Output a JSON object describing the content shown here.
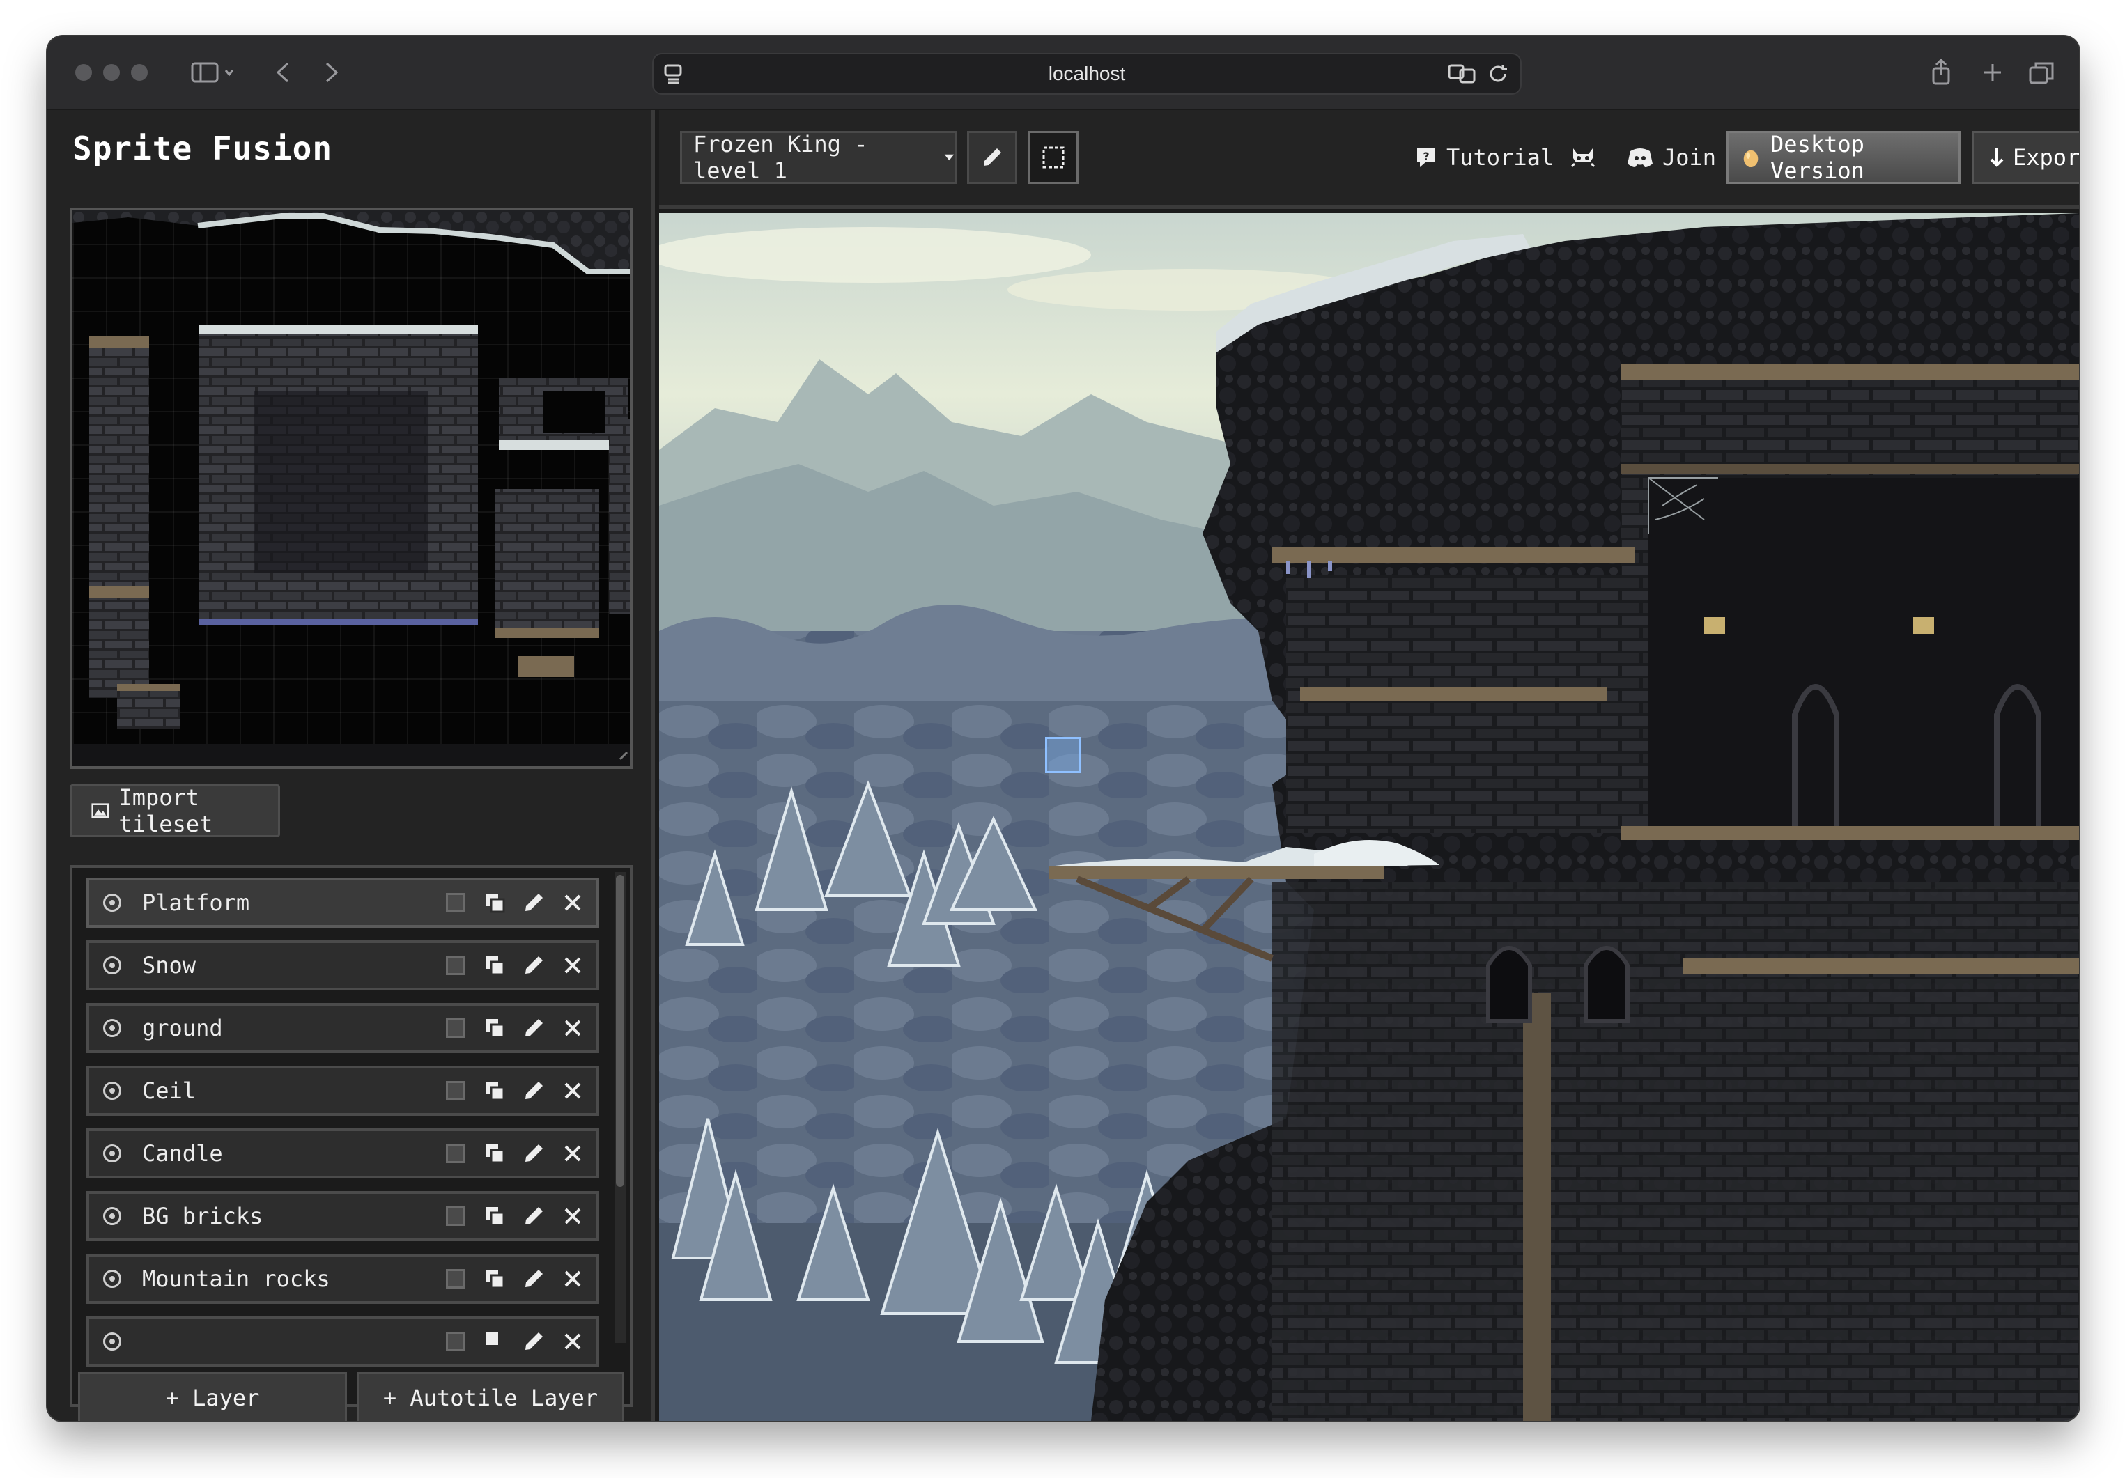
{
  "browser": {
    "url": "localhost"
  },
  "app": {
    "title": "Sprite Fusion"
  },
  "sidebar": {
    "import_label": "Import tileset",
    "layers": [
      {
        "name": "Platform"
      },
      {
        "name": "Snow"
      },
      {
        "name": "ground"
      },
      {
        "name": "Ceil"
      },
      {
        "name": "Candle"
      },
      {
        "name": "BG bricks"
      },
      {
        "name": "Mountain rocks"
      }
    ],
    "add_layer_label": "+ Layer",
    "add_autotile_label": "+ Autotile Layer"
  },
  "toolbar": {
    "level_name": "Frozen King - level 1",
    "tutorial_label": "Tutorial",
    "join_label": "Join",
    "desktop_label": "Desktop Version",
    "export_label": "Export"
  },
  "colors": {
    "panel_bg": "#232323",
    "sky_top": "#dfe6d8",
    "fog": "#8fa0a6",
    "forest": "#5f7185",
    "stone_dark": "#1c1d20",
    "stone_trim": "#7a6a52"
  }
}
